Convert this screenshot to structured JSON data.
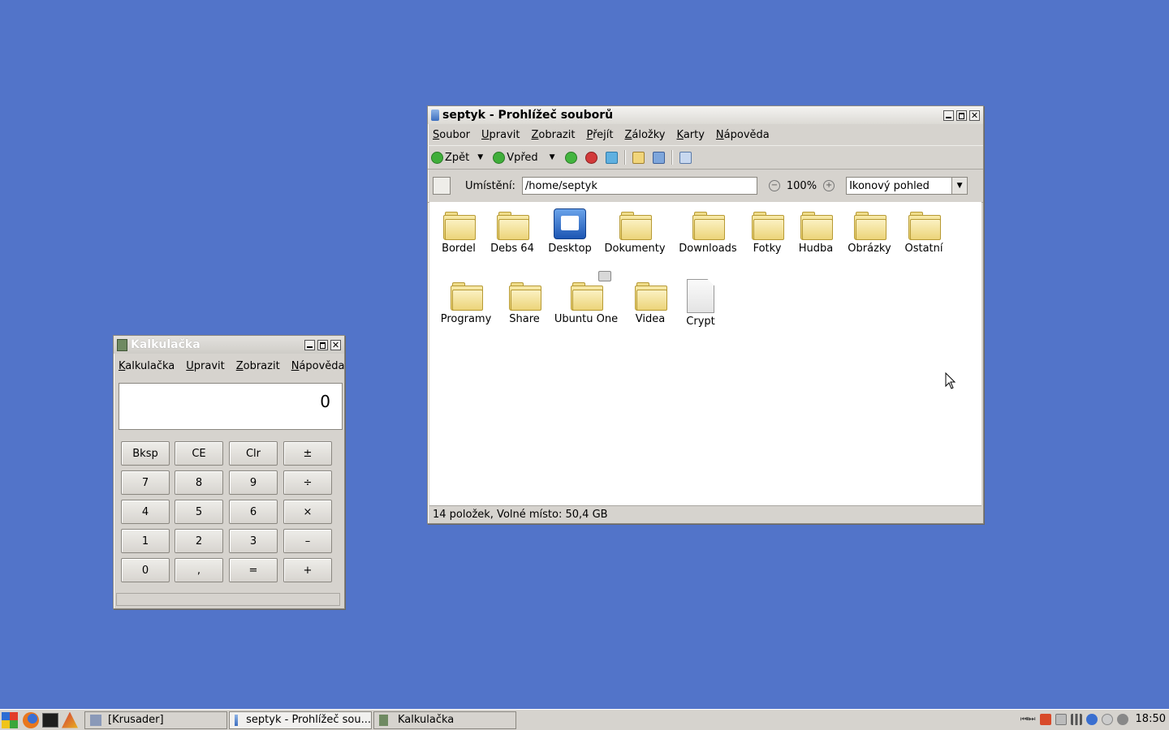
{
  "fm": {
    "title": "septyk - Prohlížeč souborů",
    "menu": [
      "Soubor",
      "Upravit",
      "Zobrazit",
      "Přejít",
      "Záložky",
      "Karty",
      "Nápověda"
    ],
    "back_label": "Zpět",
    "forward_label": "Vpřed",
    "location_label": "Umístění:",
    "location_value": "/home/septyk",
    "zoom": "100%",
    "view_mode": "Ikonový pohled",
    "items": [
      {
        "name": "Bordel",
        "icon": "folder-icon"
      },
      {
        "name": "Debs 64",
        "icon": "folder-icon"
      },
      {
        "name": "Desktop",
        "icon": "desktop-icon"
      },
      {
        "name": "Dokumenty",
        "icon": "folder-icon"
      },
      {
        "name": "Downloads",
        "icon": "folder-icon"
      },
      {
        "name": "Fotky",
        "icon": "folder-icon"
      },
      {
        "name": "Hudba",
        "icon": "folder-icon"
      },
      {
        "name": "Obrázky",
        "icon": "folder-icon"
      },
      {
        "name": "Ostatní",
        "icon": "folder-icon"
      },
      {
        "name": "Programy",
        "icon": "folder-icon"
      },
      {
        "name": "Share",
        "icon": "folder-icon"
      },
      {
        "name": "Ubuntu One",
        "icon": "locked-folder-icon"
      },
      {
        "name": "Videa",
        "icon": "folder-icon"
      },
      {
        "name": "Crypt",
        "icon": "file-icon"
      }
    ],
    "status": "14 položek, Volné místo: 50,4 GB"
  },
  "calc": {
    "title": "Kalkulačka",
    "menu": [
      "Kalkulačka",
      "Upravit",
      "Zobrazit",
      "Nápověda"
    ],
    "display": "0",
    "buttons": [
      [
        "Bksp",
        "CE",
        "Clr",
        "±"
      ],
      [
        "7",
        "8",
        "9",
        "÷"
      ],
      [
        "4",
        "5",
        "6",
        "×"
      ],
      [
        "1",
        "2",
        "3",
        "–"
      ],
      [
        "0",
        ",",
        "=",
        "+"
      ]
    ]
  },
  "taskbar": {
    "tasks": [
      "[Krusader]",
      "septyk - Prohlížeč sou...",
      "Kalkulačka"
    ],
    "clock": "18:50"
  },
  "colors": {
    "desktop": "#5274c9",
    "folder": "#ecd479"
  }
}
